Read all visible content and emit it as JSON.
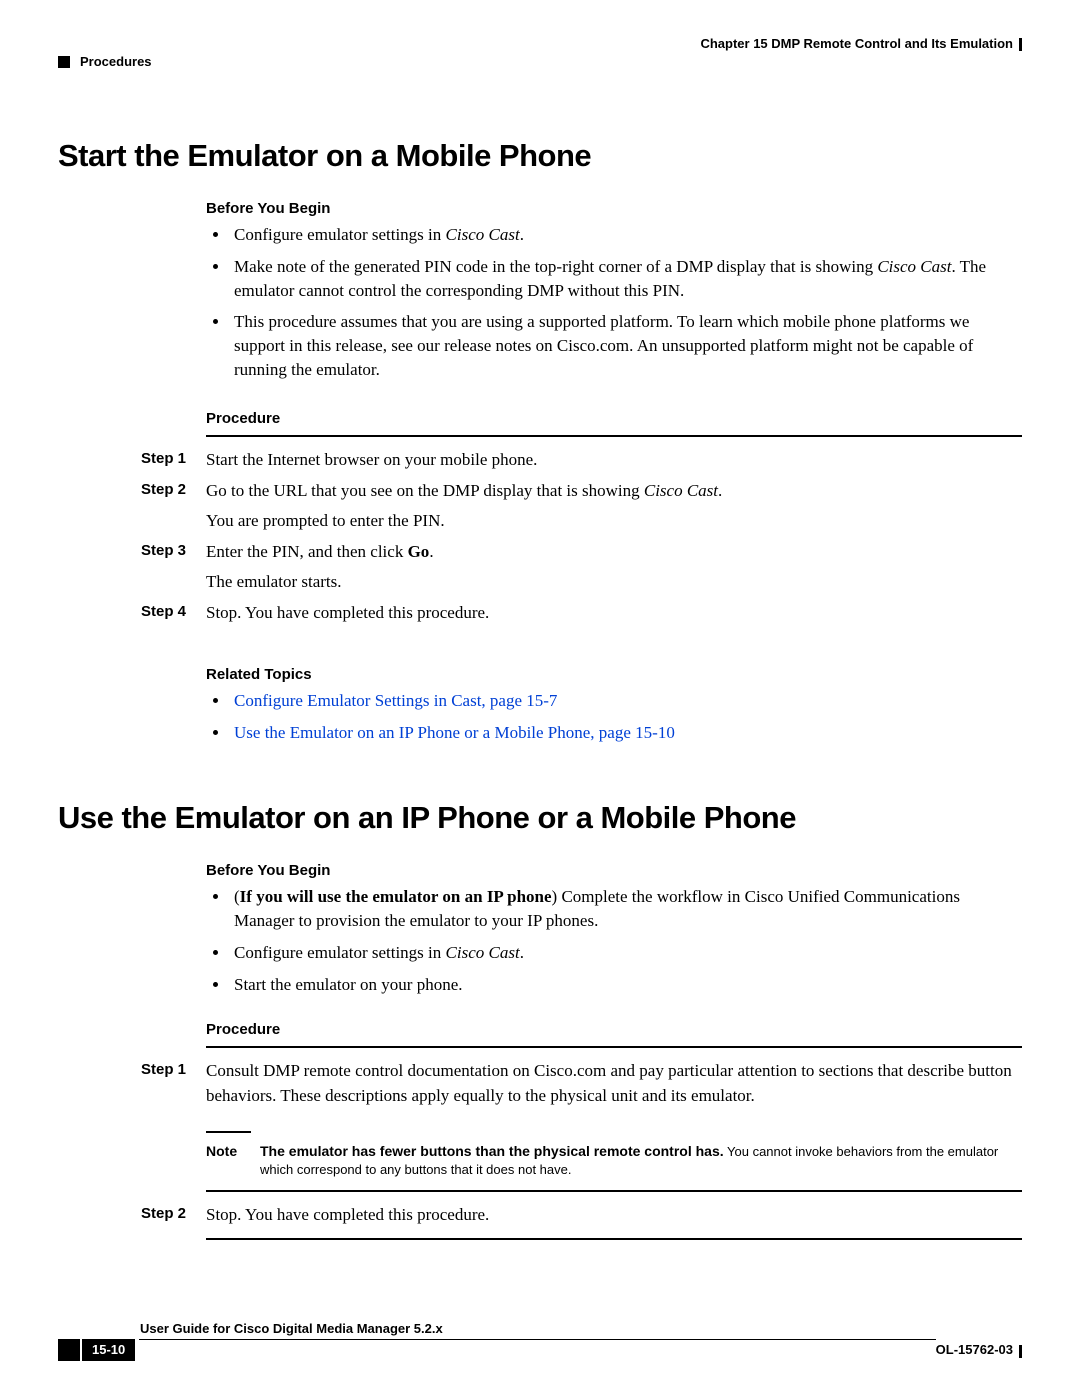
{
  "header": {
    "chapter": "Chapter 15    DMP Remote Control and Its Emulation",
    "breadcrumb": "Procedures"
  },
  "section1": {
    "title": "Start the Emulator on a Mobile Phone",
    "before_label": "Before You Begin",
    "bullets": {
      "b1_a": "Configure emulator settings in ",
      "b1_em": "Cisco Cast",
      "b1_b": ".",
      "b2_a": "Make note of the generated PIN code in the top-right corner of a DMP display that is showing ",
      "b2_em": "Cisco Cast",
      "b2_b": ". The emulator cannot control the corresponding DMP without this PIN.",
      "b3": "This procedure assumes that you are using a supported platform. To learn which mobile phone platforms we support in this release, see our release notes on Cisco.com. An unsupported platform might not be capable of running the emulator."
    },
    "procedure_label": "Procedure",
    "steps": {
      "s1_lbl": "Step 1",
      "s1": "Start the Internet browser on your mobile phone.",
      "s2_lbl": "Step 2",
      "s2_a": "Go to the URL that you see on the DMP display that is showing ",
      "s2_em": "Cisco Cast",
      "s2_b": ".",
      "s2_cont": "You are prompted to enter the PIN.",
      "s3_lbl": "Step 3",
      "s3_a": "Enter the PIN, and then click ",
      "s3_bold": "Go",
      "s3_b": ".",
      "s3_cont": "The emulator starts.",
      "s4_lbl": "Step 4",
      "s4": "Stop. You have completed this procedure."
    },
    "related_label": "Related Topics",
    "related": {
      "r1": "Configure Emulator Settings in Cast, page 15-7",
      "r2": "Use the Emulator on an IP Phone or a Mobile Phone, page 15-10"
    }
  },
  "section2": {
    "title": "Use the Emulator on an IP Phone or a Mobile Phone",
    "before_label": "Before You Begin",
    "bullets": {
      "b1_a": "(",
      "b1_bold": "If you will use the emulator on an IP phone",
      "b1_b": ") Complete the workflow in Cisco Unified Communications Manager to provision the emulator to your IP phones.",
      "b2_a": "Configure emulator settings in ",
      "b2_em": "Cisco Cast",
      "b2_b": ".",
      "b3": "Start the emulator on your phone."
    },
    "procedure_label": "Procedure",
    "steps": {
      "s1_lbl": "Step 1",
      "s1": "Consult DMP remote control documentation on Cisco.com and pay particular attention to sections that describe button behaviors. These descriptions apply equally to the physical unit and its emulator.",
      "s2_lbl": "Step 2",
      "s2": "Stop. You have completed this procedure."
    },
    "note": {
      "lbl": "Note",
      "bold": "The emulator has fewer buttons than the physical remote control has.",
      "rest": " You cannot invoke behaviors from the emulator which correspond to any buttons that it does not have."
    }
  },
  "footer": {
    "book": "User Guide for Cisco Digital Media Manager 5.2.x",
    "page": "15-10",
    "doc": "OL-15762-03"
  }
}
